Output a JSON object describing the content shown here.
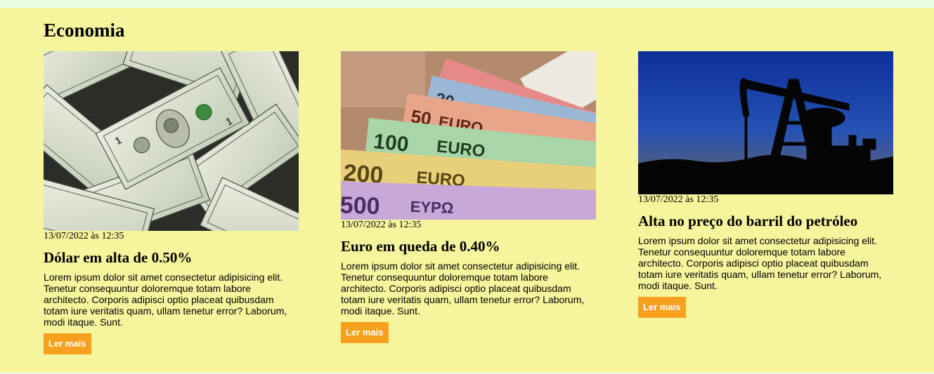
{
  "section": {
    "title": "Economia"
  },
  "articles": [
    {
      "image_icon": "dollar-bills-image",
      "date": "13/07/2022 às 12:35",
      "title": "Dólar em alta de 0.50%",
      "text": "Lorem ipsum dolor sit amet consectetur adipisicing elit. Tenetur consequuntur doloremque totam labore architecto. Corporis adipisci optio placeat quibusdam totam iure veritatis quam, ullam tenetur error? Laborum, modi itaque. Sunt.",
      "button_label": "Ler mais"
    },
    {
      "image_icon": "euro-banknotes-image",
      "date": "13/07/2022 às 12:35",
      "title": "Euro em queda de 0.40%",
      "text": "Lorem ipsum dolor sit amet consectetur adipisicing elit. Tenetur consequuntur doloremque totam labore architecto. Corporis adipisci optio placeat quibusdam totam iure veritatis quam, ullam tenetur error? Laborum, modi itaque. Sunt.",
      "button_label": "Ler mais",
      "note_values": [
        "50",
        "20",
        "100",
        "200",
        "500",
        "EURO",
        "EYPΩ"
      ]
    },
    {
      "image_icon": "oil-pump-image",
      "date": "13/07/2022 às 12:35",
      "title": "Alta no preço do barril do petróleo",
      "text": "Lorem ipsum dolor sit amet consectetur adipisicing elit. Tenetur consequuntur doloremque totam labore architecto. Corporis adipisci optio placeat quibusdam totam iure veritatis quam, ullam tenetur error? Laborum, modi itaque. Sunt.",
      "button_label": "Ler mais"
    }
  ],
  "colors": {
    "page_background": "#e9ffe6",
    "section_background": "#f6f49c",
    "button_background": "#f7a01d",
    "button_text": "#ffffff"
  }
}
